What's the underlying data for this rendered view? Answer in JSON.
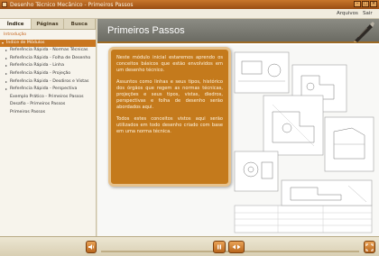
{
  "window": {
    "title": "Desenho Técnico Mecânico - Primeiros Passos"
  },
  "menu": {
    "items": [
      "Arquivos",
      "Sair"
    ]
  },
  "sidebar": {
    "tabs": [
      "Índice",
      "Páginas",
      "Busca"
    ],
    "items": [
      {
        "label": "Introdução",
        "style": "orange"
      },
      {
        "label": "Índice de Módulos",
        "style": "selected"
      },
      {
        "label": "Referência Rápida - Normas Técnicas",
        "style": "normal"
      },
      {
        "label": "Referência Rápida - Folha de Desenho",
        "style": "normal"
      },
      {
        "label": "Referência Rápida - Linha",
        "style": "normal"
      },
      {
        "label": "Referência Rápida - Projeção",
        "style": "normal"
      },
      {
        "label": "Referência Rápida - Desdiros e Vistas",
        "style": "normal"
      },
      {
        "label": "Referência Rápida - Perspectiva",
        "style": "normal"
      },
      {
        "label": "Exemplo Prático - Primeiros Passos",
        "style": "normal"
      },
      {
        "label": "Desafio - Primeiros Passos",
        "style": "normal"
      },
      {
        "label": "Primeiros Passos",
        "style": "normal"
      }
    ]
  },
  "content": {
    "page_title": "Primeiros Passos",
    "paragraphs": [
      "Neste módulo inicial estaremos aprendo os conceitos básicos que estão envolvidos em um desenho técnico.",
      "Assuntos como linhas e seus tipos, histórico dos órgãos que regem as normas técnicas, projeções e seus tipos, vistas, diedros, perspectivas e folha de desenho serão abordados aqui.",
      "Todos estes conceitos vistos aqui serão utilizados em todo desenho criado com base em uma norma técnica."
    ]
  },
  "controls": {
    "sound_icon": "speaker-icon",
    "pause_icon": "pause-icon",
    "nav_icon": "prev-next-icon",
    "fullscreen_icon": "fullscreen-icon"
  },
  "colors": {
    "accent": "#c47a1c",
    "title_bar": "#b5611e",
    "header": "#7c7c74"
  }
}
